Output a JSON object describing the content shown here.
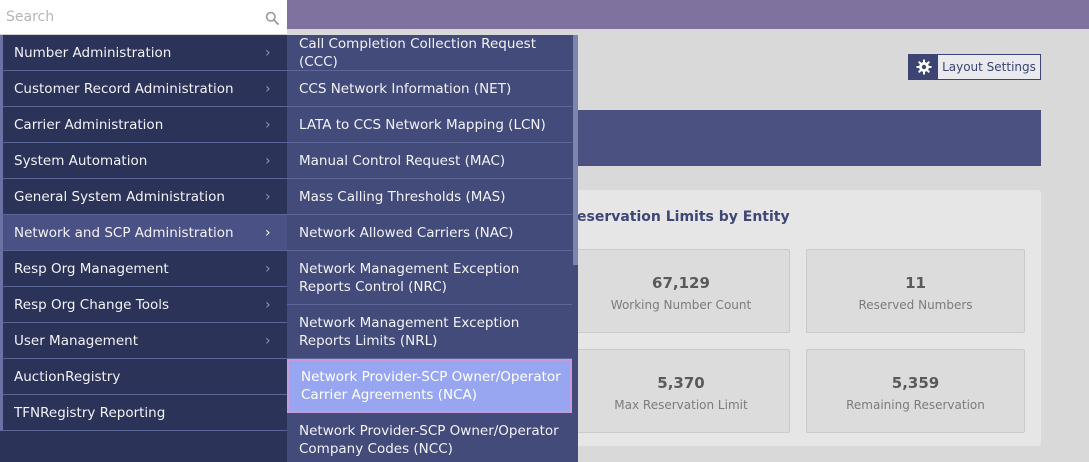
{
  "search": {
    "placeholder": "Search"
  },
  "menu": {
    "items": [
      {
        "label": "Number Administration",
        "has_children": true
      },
      {
        "label": "Customer Record Administration",
        "has_children": true
      },
      {
        "label": "Carrier Administration",
        "has_children": true
      },
      {
        "label": "System Automation",
        "has_children": true
      },
      {
        "label": "General System Administration",
        "has_children": true
      },
      {
        "label": "Network and SCP Administration",
        "has_children": true,
        "active": true
      },
      {
        "label": "Resp Org Management",
        "has_children": true
      },
      {
        "label": "Resp Org Change Tools",
        "has_children": true
      },
      {
        "label": "User Management",
        "has_children": true
      },
      {
        "label": "AuctionRegistry",
        "has_children": false
      },
      {
        "label": "TFNRegistry Reporting",
        "has_children": false
      }
    ]
  },
  "submenu": {
    "items": [
      {
        "label": "Call Completion Collection Request (CCC)"
      },
      {
        "label": "CCS Network Information (NET)"
      },
      {
        "label": "LATA to CCS Network Mapping (LCN)"
      },
      {
        "label": "Manual Control Request (MAC)"
      },
      {
        "label": "Mass Calling Thresholds (MAS)"
      },
      {
        "label": "Network Allowed Carriers (NAC)"
      },
      {
        "label": "Network Management Exception Reports Control (NRC)"
      },
      {
        "label": "Network Management Exception Reports Limits (NRL)"
      },
      {
        "label": "Network Provider-SCP Owner/Operator Carrier Agreements (NCA)",
        "active": true
      },
      {
        "label": "Network Provider-SCP Owner/Operator Company Codes (NCC)"
      }
    ]
  },
  "header": {
    "layout_settings_label": "Layout Settings"
  },
  "dashboard": {
    "card_title": "eservation Limits by Entity",
    "stats": [
      {
        "value": "67,129",
        "caption": "Working Number Count"
      },
      {
        "value": "11",
        "caption": "Reserved Numbers"
      },
      {
        "value": "5,370",
        "caption": "Max Reservation Limit"
      },
      {
        "value": "5,359",
        "caption": "Remaining Reservation"
      }
    ]
  },
  "icons": {
    "search": "search-icon",
    "gear": "gear-icon",
    "chevron": "chevron-right-icon"
  },
  "colors": {
    "menu_bg": "#2c3359",
    "submenu_bg": "#434b7b",
    "active_sub": "#98a6f2",
    "top_bar": "#7f729e"
  }
}
